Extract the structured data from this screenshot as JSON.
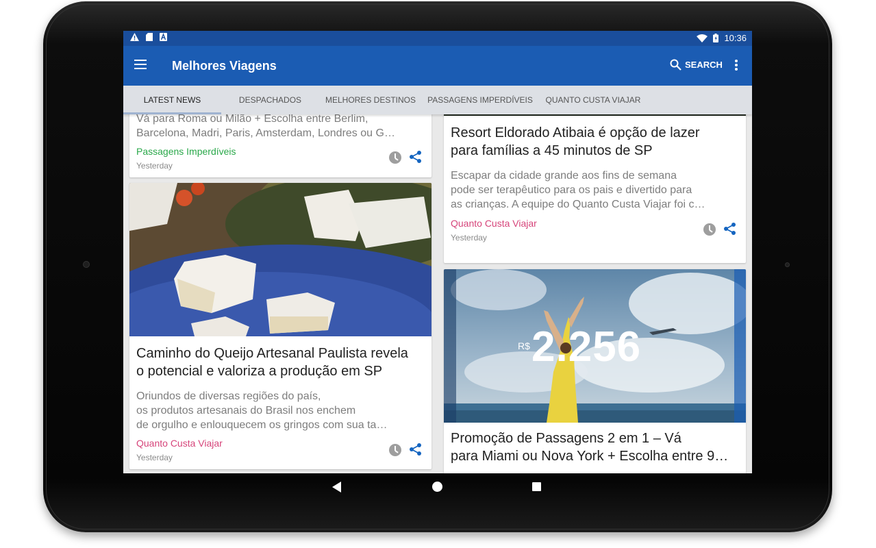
{
  "statusbar": {
    "time": "10:36"
  },
  "appbar": {
    "title": "Melhores Viagens",
    "search_label": "SEARCH"
  },
  "tabs": [
    {
      "label": "LATEST NEWS"
    },
    {
      "label": "DESPACHADOS"
    },
    {
      "label": "MELHORES DESTINOS"
    },
    {
      "label": "PASSAGENS IMPERDÍVEIS"
    },
    {
      "label": "QUANTO CUSTA VIAJAR"
    }
  ],
  "cards": {
    "top_left": {
      "excerpt_line1": "Vá para Roma ou Milão + Escolha entre Berlim,",
      "excerpt_line2": "Barcelona, Madri, Paris, Amsterdam, Londres ou G…",
      "category": "Passagens Imperdíveis",
      "category_color": "#2aa84a",
      "date": "Yesterday"
    },
    "cheese": {
      "title_line1": "Caminho do Queijo Artesanal Paulista revela",
      "title_line2": "o potencial e valoriza a produção em SP",
      "excerpt_line1": "Oriundos de diversas regiões do país,",
      "excerpt_line2": "os produtos artesanais do Brasil nos enchem",
      "excerpt_line3": "de orgulho e enlouquecem os gringos com sua ta…",
      "category": "Quanto Custa Viajar",
      "category_color": "#d6447a",
      "date": "Yesterday"
    },
    "resort": {
      "title_line1": "Resort Eldorado Atibaia é opção de lazer",
      "title_line2": "para famílias a 45 minutos de SP",
      "excerpt_line1": "Escapar da cidade grande aos fins de semana",
      "excerpt_line2": "pode ser terapêutico para os pais e divertido para",
      "excerpt_line3": "as crianças. A equipe do Quanto Custa Viajar foi c…",
      "category": "Quanto Custa Viajar",
      "category_color": "#d6447a",
      "date": "Yesterday"
    },
    "promo": {
      "image_currency": "R$",
      "image_price": "2.256",
      "title_line1": "Promoção de Passagens 2 em 1 – Vá",
      "title_line2": "para Miami ou Nova York + Escolha entre 9…"
    }
  },
  "colors": {
    "appbar": "#1b5cb3",
    "statusbar": "#1a4e9c",
    "share": "#1565c0"
  }
}
